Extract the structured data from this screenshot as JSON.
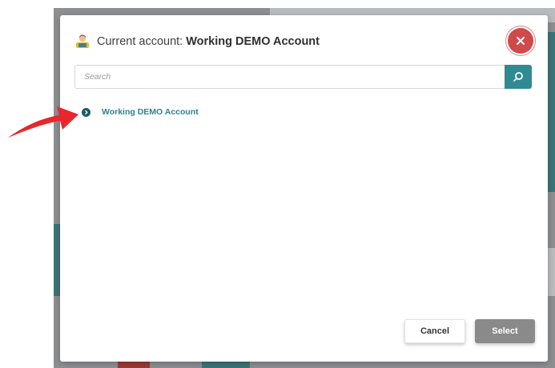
{
  "modal": {
    "header_prefix": "Current account: ",
    "header_account": "Working DEMO Account",
    "icon": "account-user-icon",
    "close_icon": "close-icon",
    "close_color": "#cf4a4a"
  },
  "search": {
    "placeholder": "Search",
    "value": "",
    "button_icon": "search-icon",
    "button_color": "#2f8a93"
  },
  "accounts": [
    {
      "label": "Working DEMO Account",
      "toggle_icon": "chevron-right-icon"
    }
  ],
  "footer": {
    "cancel_label": "Cancel",
    "select_label": "Select"
  },
  "annotation": {
    "icon": "red-arrow-icon",
    "color": "#e8272d"
  }
}
